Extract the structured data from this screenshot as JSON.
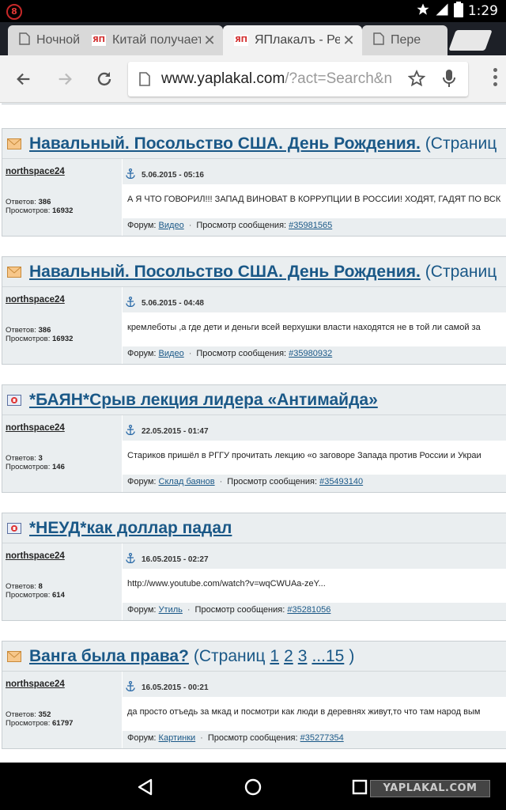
{
  "status_bar": {
    "notification": "8",
    "time": "1:29"
  },
  "tabs": [
    {
      "title": "Ночной",
      "favicon": "page-icon",
      "active": false
    },
    {
      "title": "Китай получает",
      "favicon": "yaplakal-favicon",
      "active": false
    },
    {
      "title": "ЯПлакалъ - Ре",
      "favicon": "yaplakal-favicon",
      "active": true
    },
    {
      "title": "Пере",
      "favicon": "page-icon",
      "active": false
    }
  ],
  "favicon_text": "ЯП",
  "toolbar": {
    "url_host": "www.yaplakal.com",
    "url_path": "/?act=Search&n"
  },
  "results": [
    {
      "icon": "envelope-icon",
      "title": "Навальный. Посольство США. День Рождения.",
      "suffix": "(Страниц",
      "pages": [],
      "author": "northspace24",
      "date": "5.06.2015 - 05:16",
      "replies_label": "Ответов:",
      "replies": "386",
      "views_label": "Просмотров:",
      "views": "16932",
      "text": "А Я ЧТО ГОВОРИЛ!!! ЗАПАД ВИНОВАТ В КОРРУПЦИИ В РОССИИ! ХОДЯТ, ГАДЯТ ПО ВСК",
      "forum_label": "Форум:",
      "forum": "Видео",
      "post_label": "Просмотр сообщения:",
      "post": "#35981565"
    },
    {
      "icon": "envelope-icon",
      "title": "Навальный. Посольство США. День Рождения.",
      "suffix": "(Страниц",
      "pages": [],
      "author": "northspace24",
      "date": "5.06.2015 - 04:48",
      "replies_label": "Ответов:",
      "replies": "386",
      "views_label": "Просмотров:",
      "views": "16932",
      "text": "кремлеботы ,а где дети и деньги всей верхушки власти находятся не в той ли самой за",
      "forum_label": "Форум:",
      "forum": "Видео",
      "post_label": "Просмотр сообщения:",
      "post": "#35980932"
    },
    {
      "icon": "bayan-icon",
      "title": "*БАЯН*Срыв лекция лидера «Антимайда»",
      "suffix": "",
      "pages": [],
      "author": "northspace24",
      "date": "22.05.2015 - 01:47",
      "replies_label": "Ответов:",
      "replies": "3",
      "views_label": "Просмотров:",
      "views": "146",
      "text": "Стариков пришёл в РГГУ прочитать лекцию «о заговоре Запада против России и Украи",
      "forum_label": "Форум:",
      "forum": "Склад баянов",
      "post_label": "Просмотр сообщения:",
      "post": "#35493140"
    },
    {
      "icon": "bayan-icon",
      "title": "*НЕУД*как доллар падал",
      "suffix": "",
      "pages": [],
      "author": "northspace24",
      "date": "16.05.2015 - 02:27",
      "replies_label": "Ответов:",
      "replies": "8",
      "views_label": "Просмотров:",
      "views": "614",
      "text": "http://www.youtube.com/watch?v=wqCWUAa-zeY...",
      "forum_label": "Форум:",
      "forum": "Утиль",
      "post_label": "Просмотр сообщения:",
      "post": "#35281056"
    },
    {
      "icon": "envelope-icon",
      "title": "Ванга была права?",
      "suffix": "(Страниц",
      "pages": [
        "1",
        "2",
        "3",
        "...15"
      ],
      "pages_end": ")",
      "author": "northspace24",
      "date": "16.05.2015 - 00:21",
      "replies_label": "Ответов:",
      "replies": "352",
      "views_label": "Просмотров:",
      "views": "61797",
      "text": "да просто отъедь за мкад и посмотри как люди в деревнях живут,то что там народ вым",
      "forum_label": "Форум:",
      "forum": "Картинки",
      "post_label": "Просмотр сообщения:",
      "post": "#35277354"
    }
  ],
  "watermark": "YAPLAKAL.COM",
  "colors": {
    "link": "#1a5887",
    "row_bg": "#eaeef0",
    "favicon_red": "#d32f2f"
  }
}
